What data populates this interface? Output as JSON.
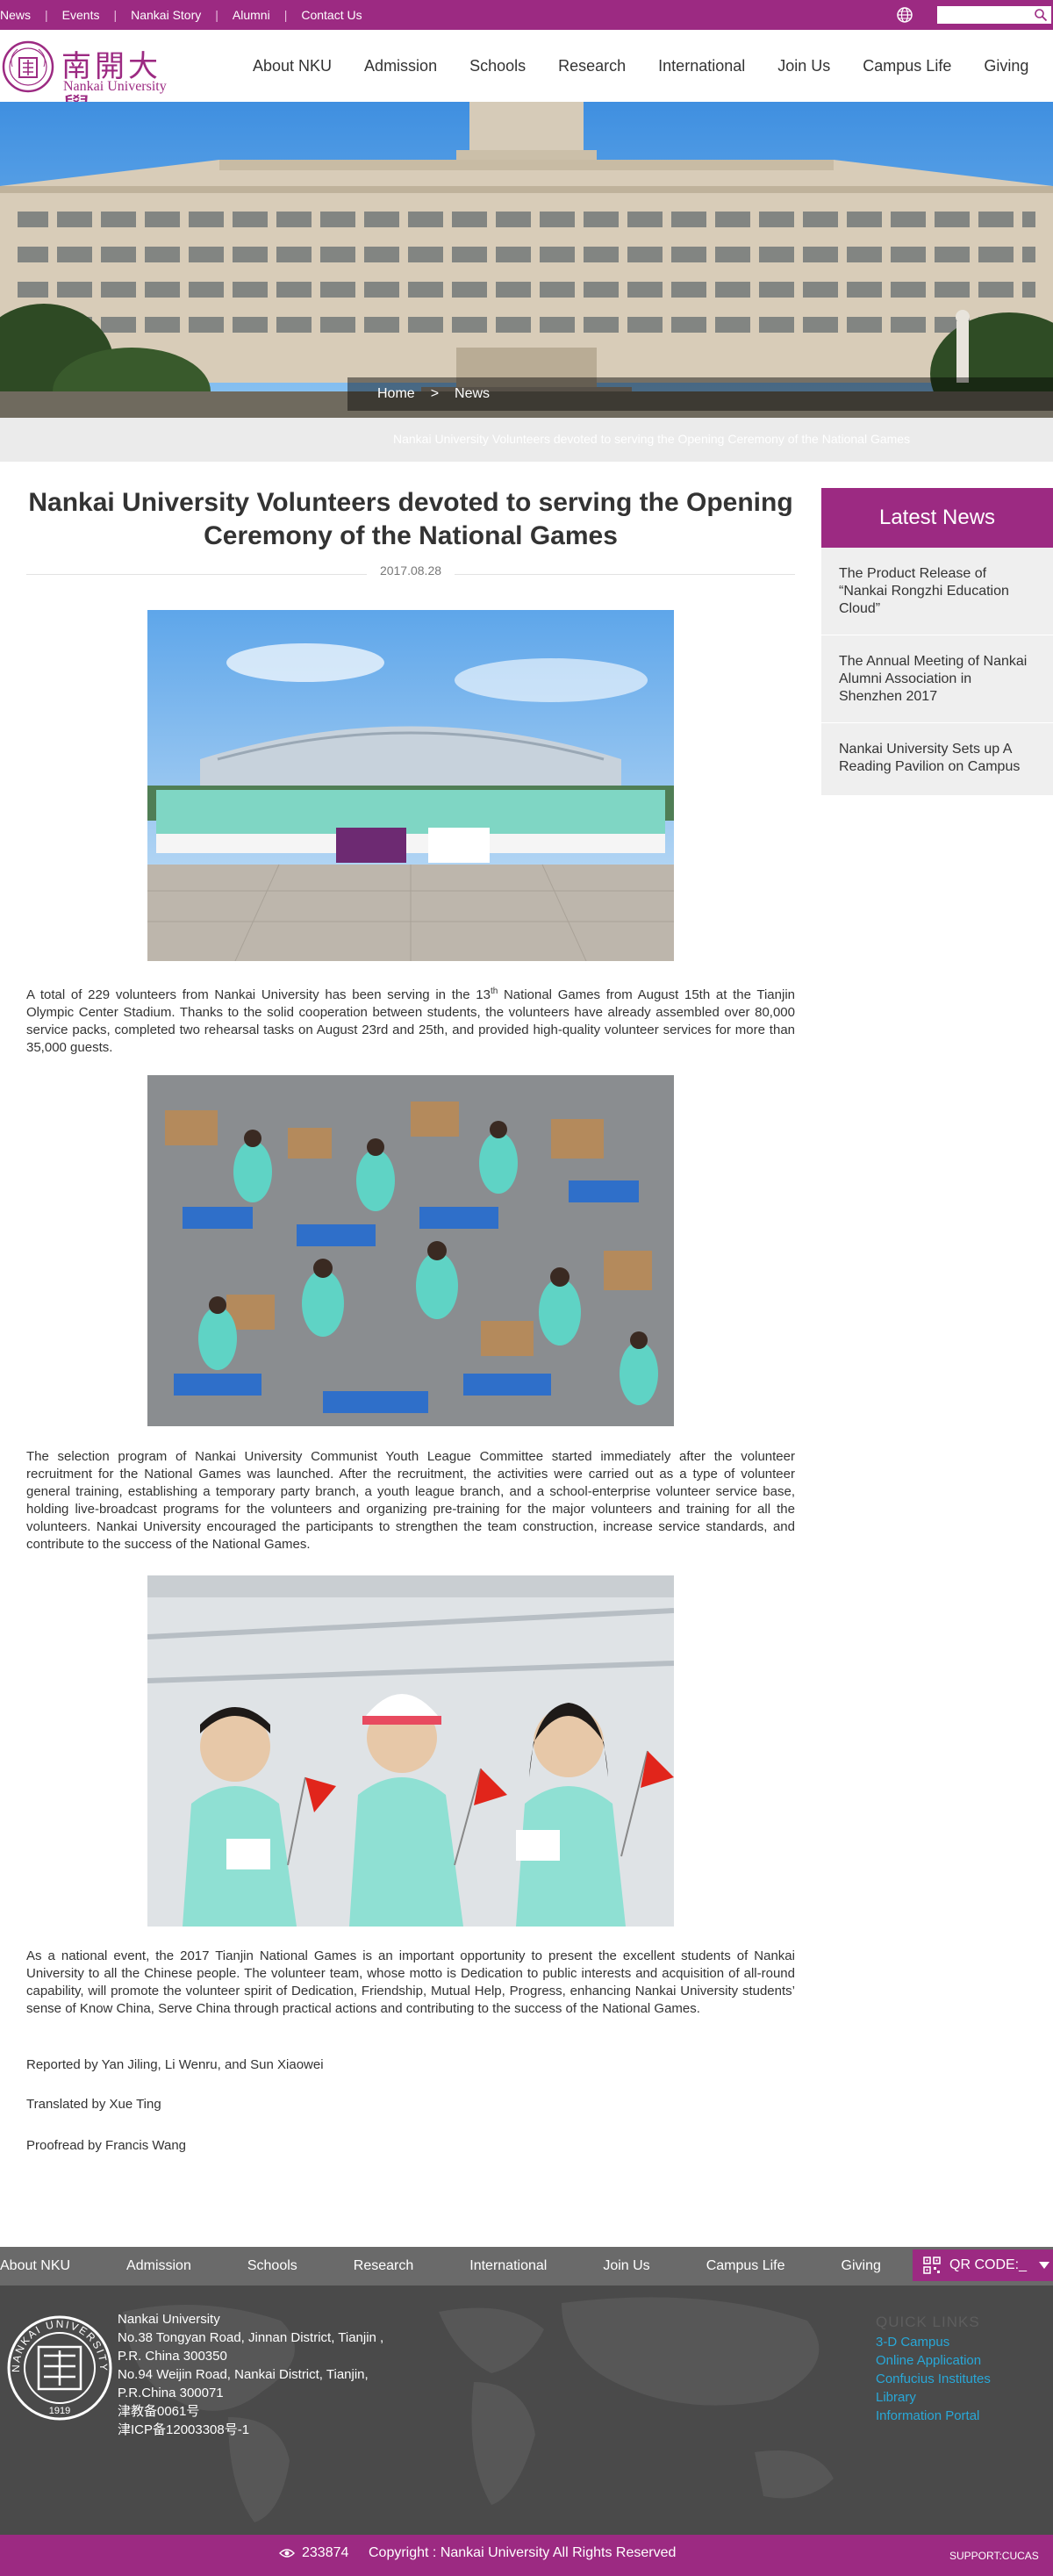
{
  "topbar": {
    "links": [
      "News",
      "Events",
      "Nankai Story",
      "Alumni",
      "Contact Us"
    ],
    "search_placeholder": ""
  },
  "header": {
    "logo_cn": "南開大學",
    "logo_en": "Nankai University",
    "nav": [
      "About NKU",
      "Admission",
      "Schools",
      "Research",
      "International",
      "Join Us",
      "Campus Life",
      "Giving"
    ]
  },
  "breadcrumb": {
    "home": "Home",
    "separator": ">",
    "current": "News"
  },
  "hero_caption": "Nankai University Volunteers devoted to serving the Opening Ceremony of the National Games",
  "article": {
    "title": "Nankai University Volunteers devoted to serving the Opening Ceremony of the National Games",
    "date": "2017.08.28",
    "para1_a": "A total of 229 volunteers from Nankai University has been serving in the 13",
    "para1_sup": "th",
    "para1_b": " National Games from August 15th at the Tianjin Olympic Center Stadium. Thanks to the solid cooperation between students, the volunteers have already assembled over 80,000 service packs, completed two rehearsal tasks on August 23rd and 25th, and provided high-quality volunteer services for more than 35,000 guests.",
    "para2": "The selection program of Nankai University Communist Youth League Committee started immediately after the volunteer recruitment for the National Games was launched. After the recruitment, the activities were carried out as a type of volunteer general training, establishing a temporary party branch, a youth league branch, and a school-enterprise volunteer service base, holding live-broadcast programs for the volunteers and organizing pre-training for the major volunteers and training for all the volunteers. Nankai University encouraged the participants to strengthen the team construction, increase service standards, and contribute to the success of the National Games.",
    "para3": "As a national event, the 2017 Tianjin National Games is an important opportunity to present the excellent students of Nankai University to all the Chinese people. The volunteer team, whose motto is Dedication to public interests and acquisition of all-round capability, will promote the volunteer spirit of Dedication, Friendship, Mutual Help, Progress, enhancing Nankai University students’ sense of Know China, Serve China through practical actions and contributing to the success of the National Games.",
    "reported": "Reported by Yan Jiling, Li Wenru, and Sun Xiaowei",
    "translated": "Translated by Xue Ting",
    "proofread": "Proofread by Francis Wang"
  },
  "sidebar": {
    "heading": "Latest News",
    "items": [
      "The Product Release of “Nankai Rongzhi Education Cloud”",
      "The Annual Meeting of Nankai Alumni Association in Shenzhen 2017",
      "Nankai University Sets up A Reading Pavilion on Campus"
    ]
  },
  "footer": {
    "nav": [
      "About NKU",
      "Admission",
      "Schools",
      "Research",
      "International",
      "Join Us",
      "Campus Life",
      "Giving"
    ],
    "qr_label": "QR CODE:_",
    "address": [
      "Nankai University",
      "No.38 Tongyan Road, Jinnan District, Tianjin , P.R. China 300350",
      "No.94 Weijin Road,  Nankai District, Tianjin, P.R.China  300071",
      "津教备0061号",
      "津ICP备12003308号-1"
    ],
    "quick_title": "QUICK LINKS",
    "quick_links": [
      "3-D Campus",
      "Online Application",
      "Confucius Institutes",
      "Library",
      "Information Portal"
    ],
    "counter": "233874",
    "copyright": "Copyright : Nankai University All Rights Reserved",
    "support": "SUPPORT:CUCAS",
    "seal_text": "NANKAI UNIVERSITY",
    "seal_year": "1919"
  },
  "colors": {
    "brand": "#9c2a82",
    "footer_dark": "#4a4a4a",
    "footer_nav": "#6a6a6a",
    "link_blue": "#28a8d8"
  }
}
